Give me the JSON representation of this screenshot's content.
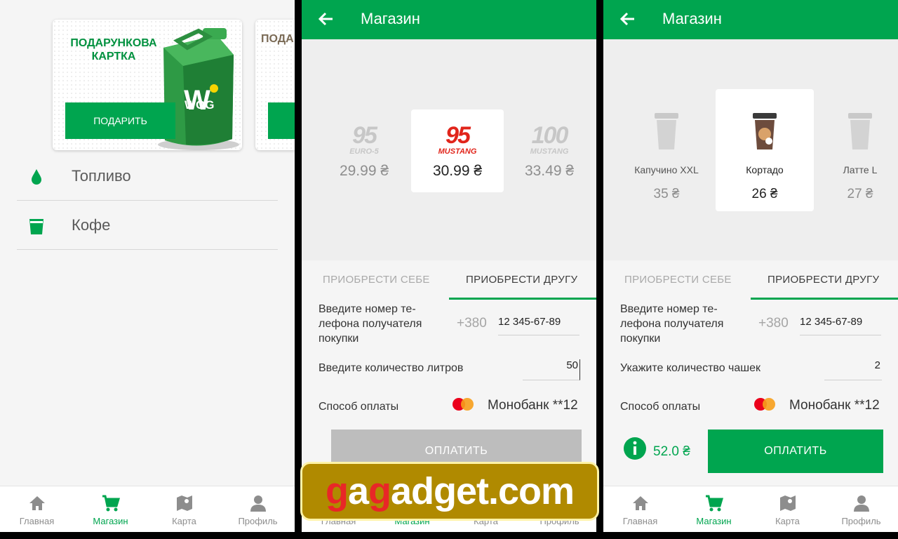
{
  "screen1": {
    "cards": [
      {
        "title": "ПОДАРУНКОВА КАРТКА",
        "button": "ПОДАРИТЬ",
        "brand": "WOG"
      },
      {
        "title": "ПОДА КА"
      }
    ],
    "menu": [
      {
        "icon": "drop-icon",
        "label": "Топливо"
      },
      {
        "icon": "cup-icon",
        "label": "Кофе"
      }
    ]
  },
  "screen2": {
    "title": "Магазин",
    "products": [
      {
        "num": "95",
        "sub": "EURO-5",
        "price": "29.99 ₴"
      },
      {
        "num": "95",
        "sub": "MUSTANG",
        "price": "30.99 ₴"
      },
      {
        "num": "100",
        "sub": "MUSTANG",
        "price": "33.49 ₴"
      }
    ],
    "tabs": [
      "ПРИОБРЕСТИ СЕБЕ",
      "ПРИОБРЕСТИ ДРУГУ"
    ],
    "phone_label": "Введите номер те-\nлефона получателя\nпокупки",
    "phone_prefix": "+380",
    "phone_value": "12 345-67-89",
    "qty_label": "Введите количество литров",
    "qty_value": "50",
    "payment_label": "Способ оплаты",
    "payment_method": "Монобанк **12",
    "pay_button": "ОПЛАТИТЬ"
  },
  "screen3": {
    "title": "Магазин",
    "products": [
      {
        "name": "Капучино XXL",
        "price": "35 ₴"
      },
      {
        "name": "Кортадо",
        "price": "26 ₴"
      },
      {
        "name": "Латте L",
        "price": "27 ₴"
      }
    ],
    "tabs": [
      "ПРИОБРЕСТИ СЕБЕ",
      "ПРИОБРЕСТИ ДРУГУ"
    ],
    "phone_label": "Введите номер те-\nлефона получателя\nпокупки",
    "phone_prefix": "+380",
    "phone_value": "12 345-67-89",
    "qty_label": "Укажите количество чашек",
    "qty_value": "2",
    "payment_label": "Способ оплаты",
    "payment_method": "Монобанк **12",
    "total": "52.0 ₴",
    "pay_button": "ОПЛАТИТЬ"
  },
  "nav": [
    "Главная",
    "Магазин",
    "Карта",
    "Профиль"
  ],
  "watermark": {
    "g1": "g",
    "a1": "a",
    "g2": "g",
    "rest": "adget.com"
  },
  "colors": {
    "accent": "#00a54f",
    "fuel95": "#e1251b",
    "disabled_button": "#bdbdbd"
  }
}
